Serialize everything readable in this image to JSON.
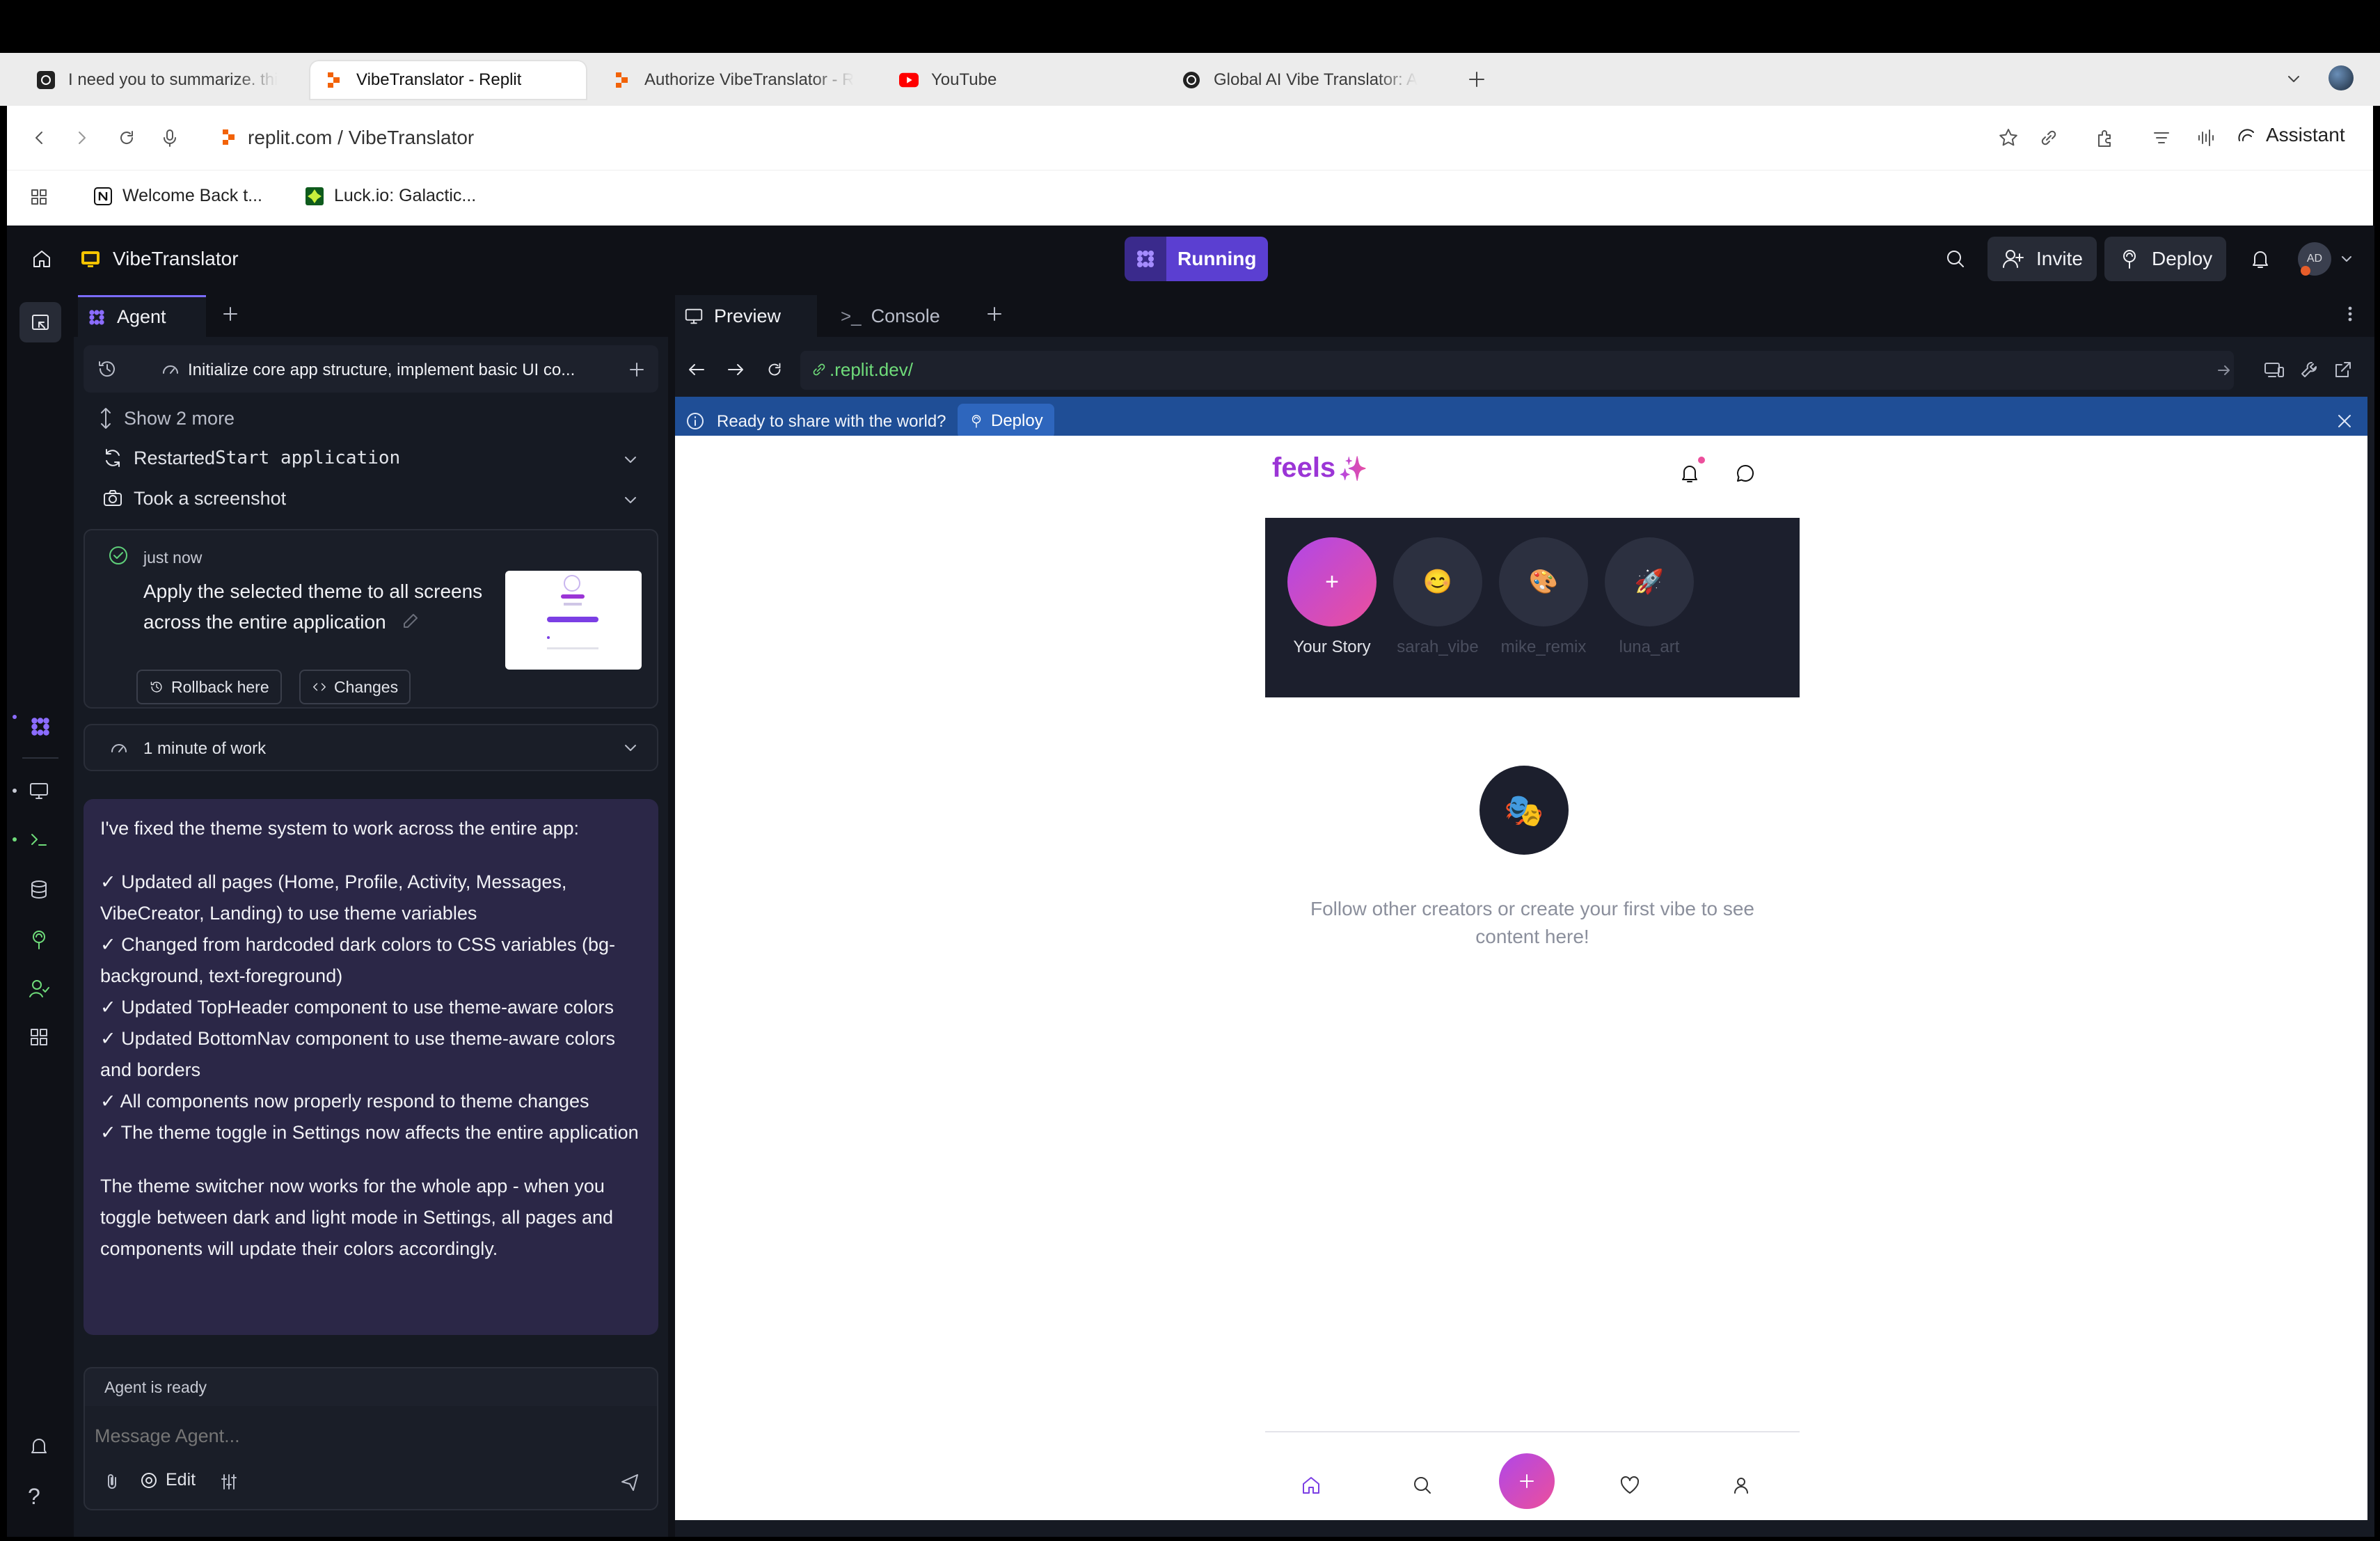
{
  "browser": {
    "tabs": [
      {
        "title": "I need you to summarize. thi",
        "icon": "chatgpt-icon",
        "active": false
      },
      {
        "title": "VibeTranslator - Replit",
        "icon": "replit-icon",
        "active": true
      },
      {
        "title": "Authorize VibeTranslator - R",
        "icon": "replit-icon",
        "active": false
      },
      {
        "title": "YouTube",
        "icon": "youtube-icon",
        "active": false
      },
      {
        "title": "Global AI Vibe Translator: A",
        "icon": "openai-icon",
        "active": false
      }
    ],
    "url": "replit.com / VibeTranslator",
    "assistant_label": "Assistant",
    "bookmarks": [
      {
        "label": "Welcome Back t...",
        "icon": "notion-icon"
      },
      {
        "label": "Luck.io: Galactic...",
        "icon": "luck-icon"
      }
    ]
  },
  "app": {
    "project_name": "VibeTranslator",
    "run_status": "Running",
    "invite_label": "Invite",
    "deploy_label": "Deploy",
    "avatar_initials": "AD"
  },
  "agent": {
    "tab_label": "Agent",
    "task_title": "Initialize core app structure, implement basic UI co...",
    "show_more": "Show 2 more",
    "step_restart_prefix": "Restarted ",
    "step_restart_code": "Start application",
    "step_screenshot": "Took a screenshot",
    "checkpoint_time": "just now",
    "checkpoint_text": "Apply the selected theme to all screens across the entire application",
    "rollback_label": "Rollback here",
    "changes_label": "Changes",
    "work_time": "1 minute of work",
    "message_intro": "I've fixed the theme system to work across the entire app:",
    "message_items": [
      "✓ Updated all pages (Home, Profile, Activity, Messages, VibeCreator, Landing) to use theme variables",
      "✓ Changed from hardcoded dark colors to CSS variables (bg-background, text-foreground)",
      "✓ Updated TopHeader component to use theme-aware colors",
      "✓ Updated BottomNav component to use theme-aware colors and borders",
      "✓ All components now properly respond to theme changes",
      "✓ The theme toggle in Settings now affects the entire application"
    ],
    "message_outro": "The theme switcher now works for the whole app - when you toggle between dark and light mode in Settings, all pages and components will update their colors accordingly.",
    "status": "Agent is ready",
    "input_placeholder": "Message Agent...",
    "edit_label": "Edit"
  },
  "preview": {
    "tab_preview": "Preview",
    "tab_console": "Console",
    "url": ".replit.dev/",
    "banner_text": "Ready to share with the world?",
    "banner_deploy": "Deploy",
    "logo": "feels",
    "stories": [
      {
        "name": "Your Story",
        "emoji": "+"
      },
      {
        "name": "sarah_vibe",
        "emoji": "😊"
      },
      {
        "name": "mike_remix",
        "emoji": "🎨"
      },
      {
        "name": "luna_art",
        "emoji": "🚀"
      }
    ],
    "empty_emoji": "🎭",
    "empty_text_line1": "Follow other creators or create your first vibe to see",
    "empty_text_line2": "content here!"
  },
  "colors": {
    "accent_purple": "#7b3fe4",
    "running_bg": "#5b3fd1",
    "banner_blue": "#1f4e96",
    "feels_purple": "#9b35d6",
    "story_gradient_start": "#b047e8",
    "story_gradient_end": "#ec4f9c"
  }
}
